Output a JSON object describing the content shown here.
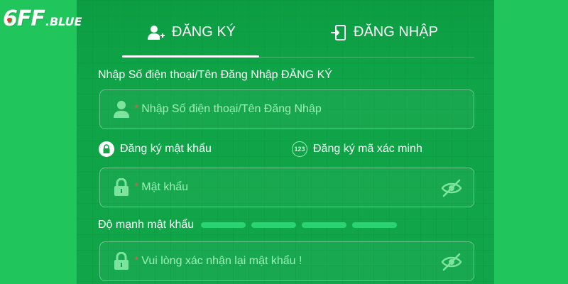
{
  "logo": {
    "main": "6FF",
    "sub": ".BLUE"
  },
  "tabs": [
    {
      "label": "ĐĂNG KÝ",
      "active": true,
      "icon": "user-add-icon"
    },
    {
      "label": "ĐĂNG NHẬP",
      "active": false,
      "icon": "login-door-icon"
    }
  ],
  "form": {
    "username_label": "Nhập Số điện thoại/Tên Đăng Nhập ĐĂNG KÝ",
    "username_placeholder": "Nhập Số điện thoại/Tên Đăng Nhập",
    "required_mark": "*",
    "options": [
      {
        "label": "Đăng ký mật khẩu",
        "selected": true,
        "icon": "lock-icon"
      },
      {
        "label": "Đăng ký mã xác minh",
        "selected": false,
        "icon_text": "123"
      }
    ],
    "password_placeholder": "Mật khẩu",
    "strength_label": "Độ mạnh mật khẩu",
    "strength_levels": 4,
    "confirm_placeholder": "Vui lòng xác nhận lại mật khẩu !"
  },
  "colors": {
    "background": "#1fc35a",
    "panel": "#0fa548",
    "placeholder": "#9cf0b4",
    "required": "#ff4d4f",
    "strength_bar": "#2ad472"
  }
}
